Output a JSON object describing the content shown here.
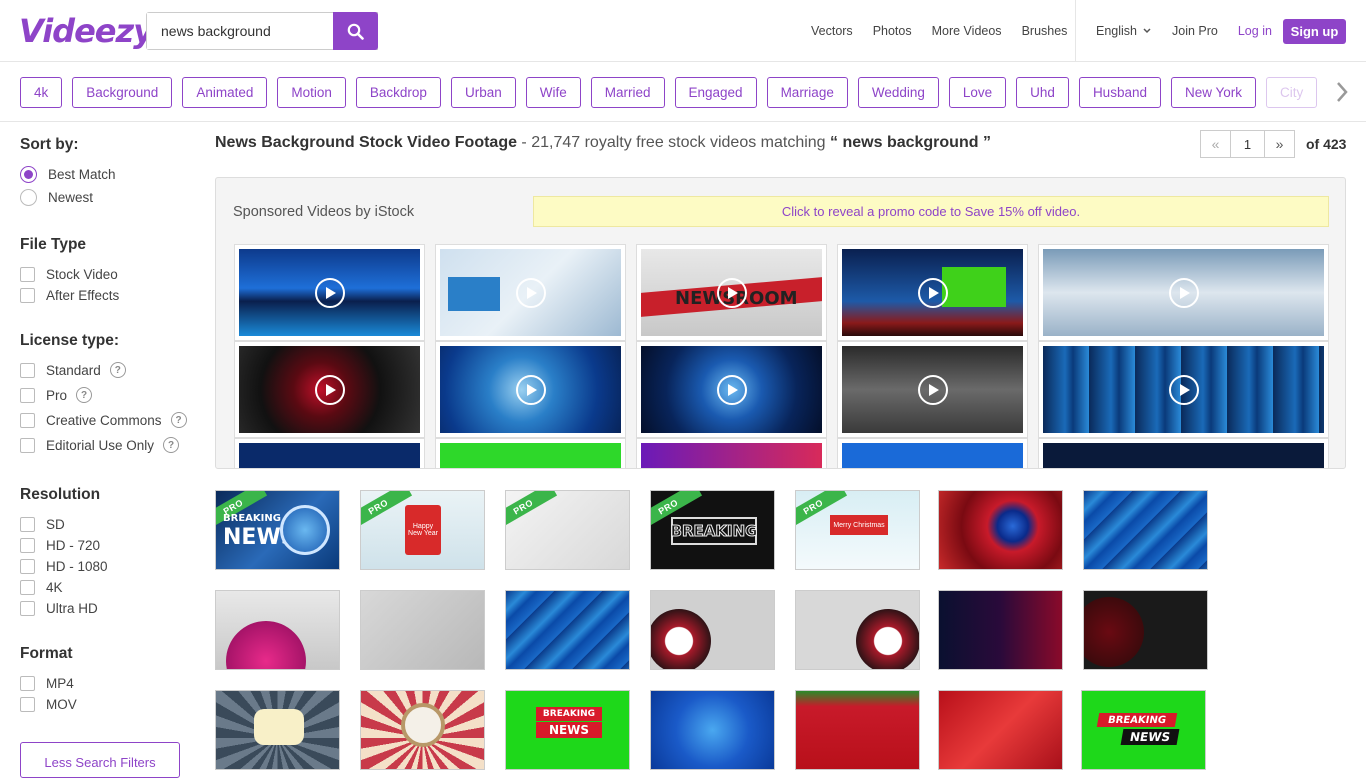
{
  "header": {
    "logo": "Videezy",
    "search_value": "news background",
    "nav": [
      "Vectors",
      "Photos",
      "More Videos",
      "Brushes"
    ],
    "language": "English",
    "join_pro": "Join Pro",
    "login": "Log in",
    "signup": "Sign up"
  },
  "tags": [
    "4k",
    "Background",
    "Animated",
    "Motion",
    "Backdrop",
    "Urban",
    "Wife",
    "Married",
    "Engaged",
    "Marriage",
    "Wedding",
    "Love",
    "Uhd",
    "Husband",
    "New York",
    "City"
  ],
  "sidebar": {
    "sort": {
      "heading": "Sort by:",
      "options": [
        "Best Match",
        "Newest"
      ],
      "selected": "Best Match"
    },
    "file_type": {
      "heading": "File Type",
      "options": [
        "Stock Video",
        "After Effects"
      ]
    },
    "license": {
      "heading": "License type:",
      "options": [
        "Standard",
        "Pro",
        "Creative Commons",
        "Editorial Use Only"
      ],
      "help_icon": "?"
    },
    "resolution": {
      "heading": "Resolution",
      "options": [
        "SD",
        "HD - 720",
        "HD - 1080",
        "4K",
        "Ultra HD"
      ]
    },
    "format": {
      "heading": "Format",
      "options": [
        "MP4",
        "MOV"
      ]
    },
    "less_filters": "Less Search Filters"
  },
  "results": {
    "title": "News Background Stock Video Footage",
    "count_text": " - 21,747 royalty free stock videos matching ",
    "query": "“ news background ”",
    "page": "1",
    "of_pages": "of 423"
  },
  "sponsored": {
    "title": "Sponsored Videos by iStock",
    "promo": "Click to reveal a promo code to Save 15% off video."
  },
  "thumb_text": {
    "breaking": "BREAKING",
    "news": "NEWS",
    "newsroom": "NEWSROOM",
    "pro": "PRO",
    "happy_new_year": "Happy New Year",
    "merry_christmas": "Merry Christmas"
  },
  "colors": {
    "brand": "#8e44c8",
    "pro_badge": "#3bb54a",
    "promo_bg": "#fdfbc4"
  }
}
